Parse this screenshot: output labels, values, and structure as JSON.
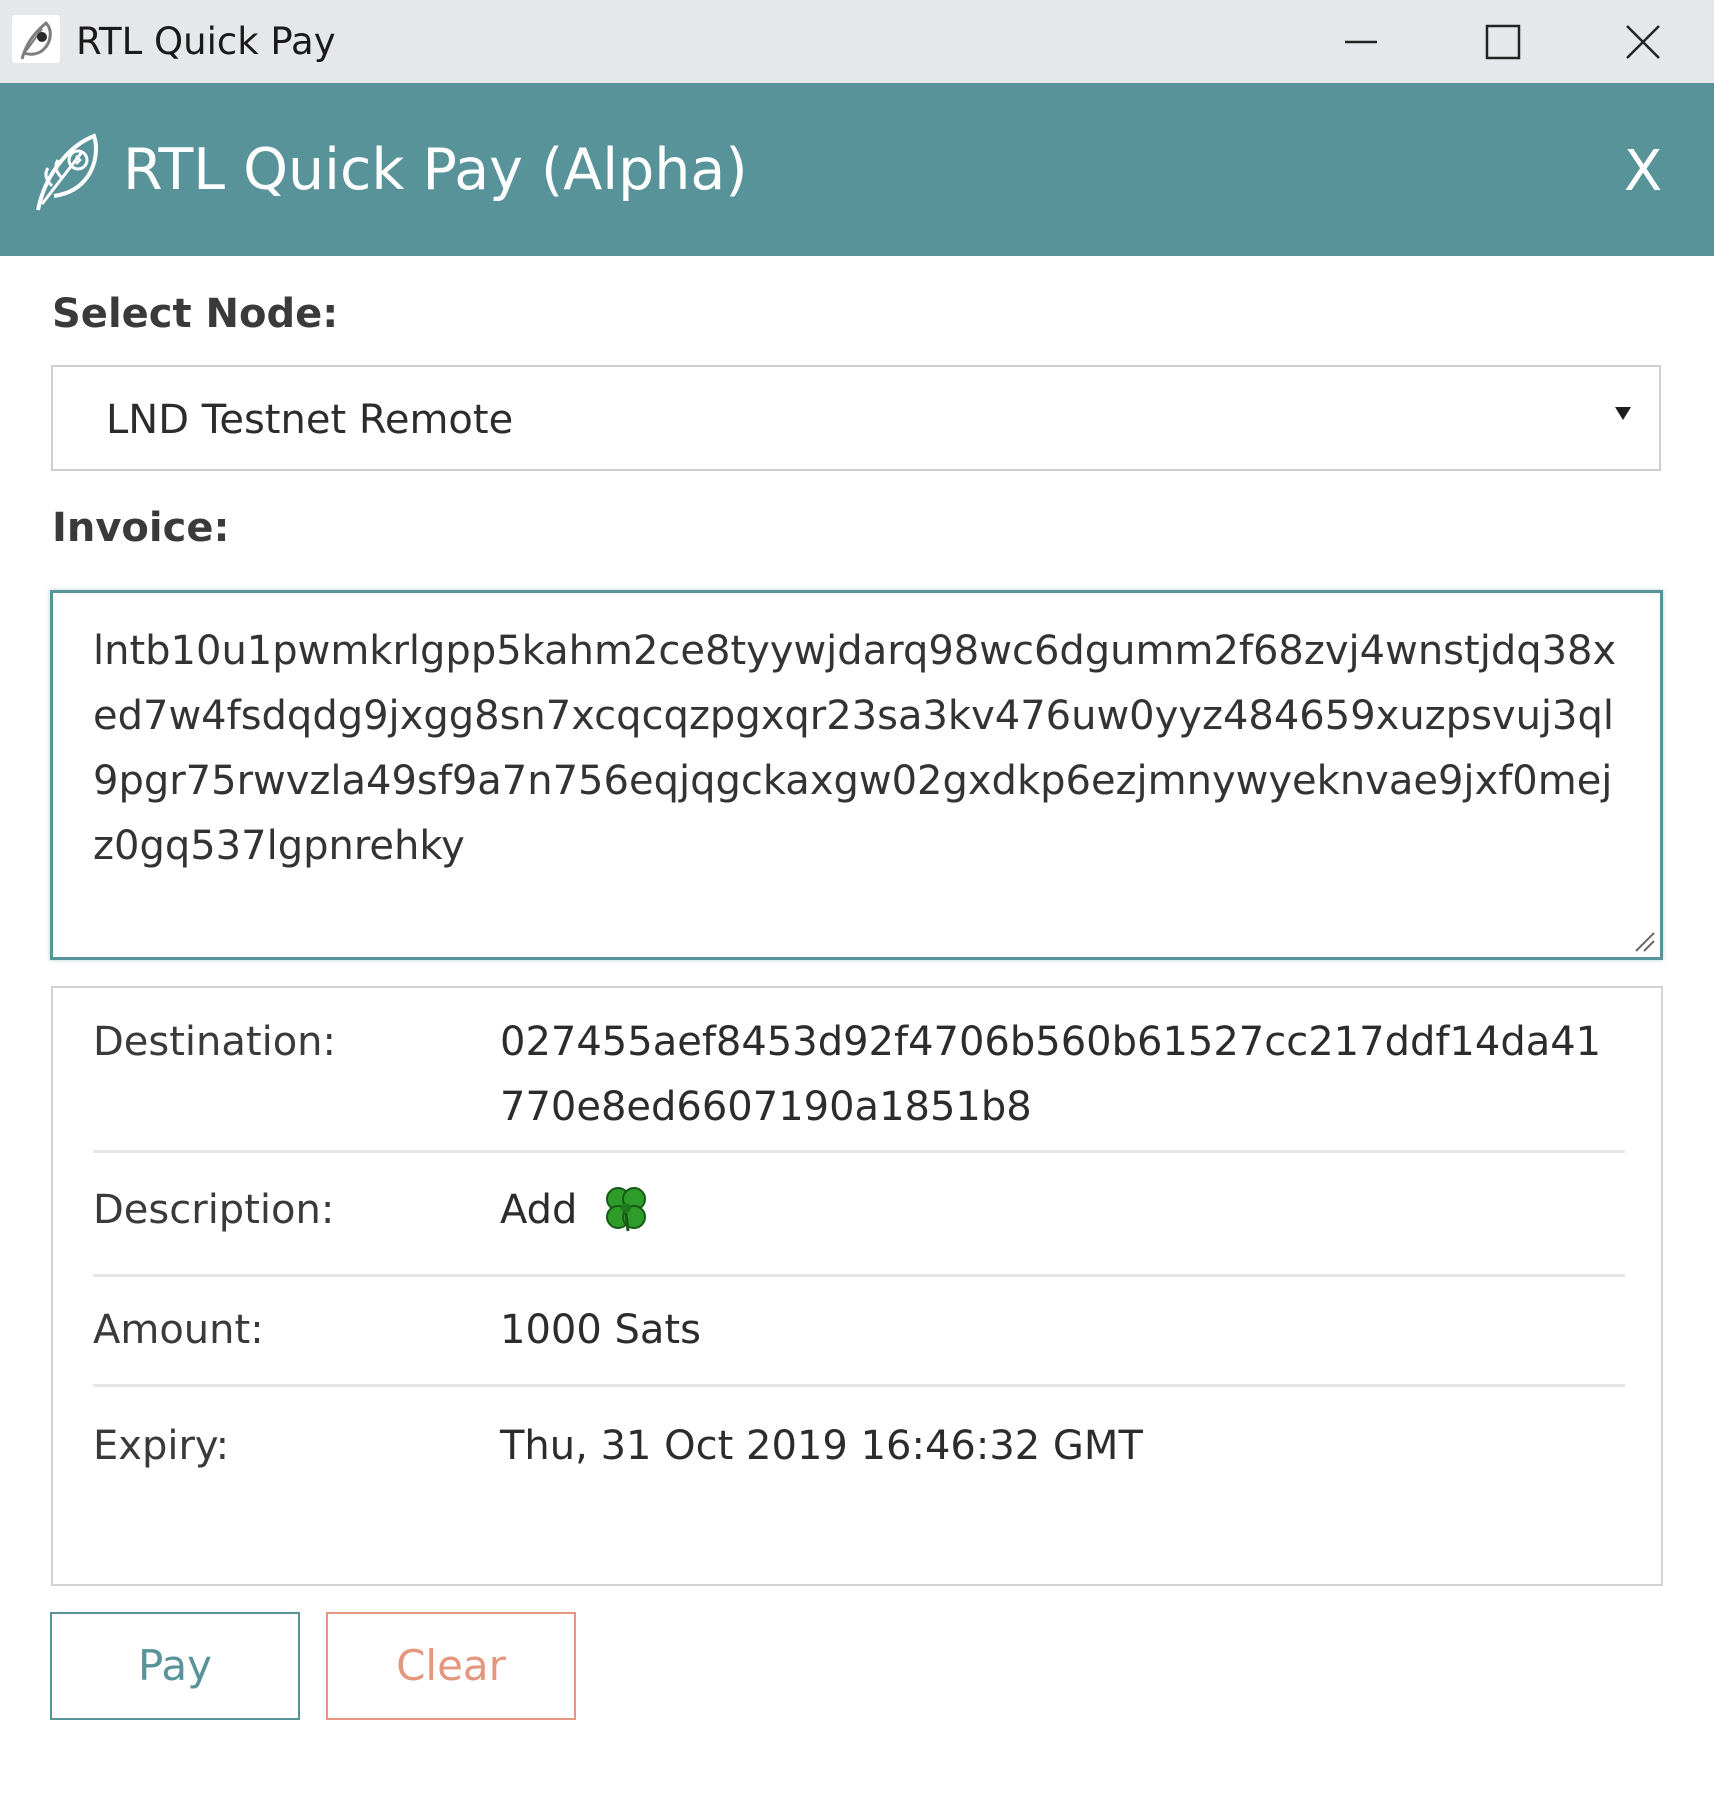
{
  "window": {
    "title": "RTL Quick Pay",
    "icons": {
      "minimize": "minimize-icon",
      "maximize": "maximize-icon",
      "close": "close-icon"
    }
  },
  "header": {
    "title": "RTL Quick Pay (Alpha)",
    "close_label": "X",
    "color": "#58939a"
  },
  "form": {
    "node_label": "Select Node:",
    "node_value": "LND Testnet Remote",
    "invoice_label": "Invoice:",
    "invoice_value": "lntb10u1pwmkrlgpp5kahm2ce8tyywjdarq98wc6dgumm2f68zvj4wnstjdq38xed7w4fsdqdg9jxgg8sn7xcqcqzpgxqr23sa3kv476uw0yyz484659xuzpsvuj3ql9pgr75rwvzla49sf9a7n756eqjqgckaxgw02gxdkp6ezjmnywyeknvae9jxf0mejz0gq537lgpnrehky"
  },
  "details": {
    "destination_label": "Destination:",
    "destination_value": "027455aef8453d92f4706b560b61527cc217ddf14da41770e8ed6607190a1851b8",
    "description_label": "Description:",
    "description_value": "Add",
    "description_icon": "four-leaf-clover-icon",
    "amount_label": "Amount:",
    "amount_value": "1000 Sats",
    "expiry_label": "Expiry:",
    "expiry_value": "Thu, 31 Oct 2019 16:46:32 GMT"
  },
  "buttons": {
    "pay_label": "Pay",
    "clear_label": "Clear",
    "pay_color": "#58939a",
    "clear_color": "#e5967e"
  }
}
